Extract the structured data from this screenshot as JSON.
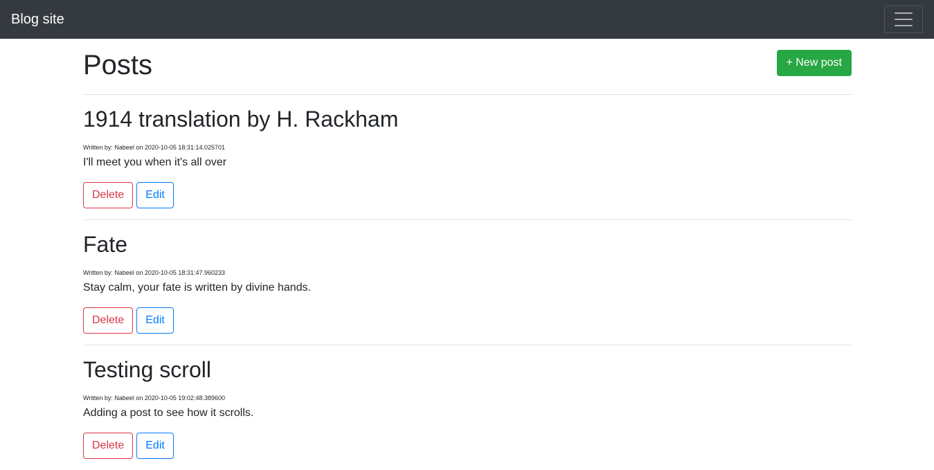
{
  "navbar": {
    "brand": "Blog site",
    "toggle_icon": "hamburger-menu-icon"
  },
  "main": {
    "title": "Posts",
    "new_post_label": "+ New post",
    "posts": [
      {
        "title": "1914 translation by H. Rackham",
        "meta": "Written by: Nabeel on 2020-10-05 18:31:14.025701",
        "body": "I'll meet you when it's all over",
        "delete_label": "Delete",
        "edit_label": "Edit"
      },
      {
        "title": "Fate",
        "meta": "Written by: Nabeel on 2020-10-05 18:31:47.960233",
        "body": "Stay calm, your fate is written by divine hands.",
        "delete_label": "Delete",
        "edit_label": "Edit"
      },
      {
        "title": "Testing scroll",
        "meta": "Written by: Nabeel on 2020-10-05 19:02:48.389600",
        "body": "Adding a post to see how it scrolls.",
        "delete_label": "Delete",
        "edit_label": "Edit"
      }
    ]
  },
  "colors": {
    "navbar_bg": "#343a40",
    "success": "#28a745",
    "danger": "#dc3545",
    "primary": "#007bff",
    "divider": "#dee2e6"
  }
}
